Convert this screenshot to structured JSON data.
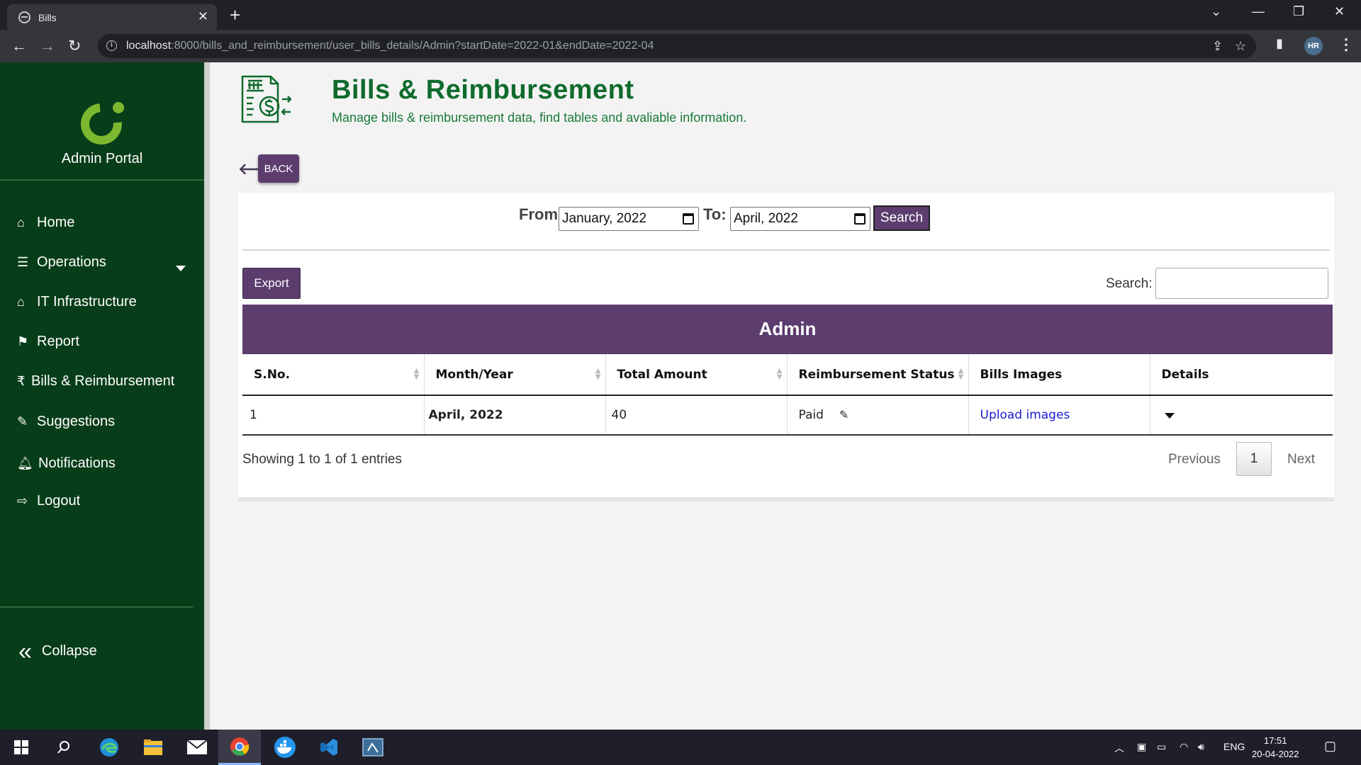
{
  "browser": {
    "tab_title": "Bills",
    "url_host": "localhost",
    "url_rest": ":8000/bills_and_reimbursement/user_bills_details/Admin?startDate=2022-01&endDate=2022-04",
    "profile_initials": "HR"
  },
  "sidebar": {
    "portal_title": "Admin Portal",
    "items": [
      {
        "label": "Home",
        "icon": "home-icon"
      },
      {
        "label": "Operations",
        "icon": "list-icon"
      },
      {
        "label": "IT Infrastructure",
        "icon": "home-icon"
      },
      {
        "label": "Report",
        "icon": "flag-icon"
      },
      {
        "label": "Bills & Reimbursement",
        "icon": "rupee-icon"
      },
      {
        "label": "Suggestions",
        "icon": "edit-icon"
      },
      {
        "label": "Notifications",
        "icon": "bell-icon"
      },
      {
        "label": "Logout",
        "icon": "logout-icon"
      }
    ],
    "collapse_label": "Collapse"
  },
  "header": {
    "title": "Bills & Reimbursement",
    "subtitle": "Manage bills & reimbursement data, find tables and avaliable information."
  },
  "back_label": "BACK",
  "filter": {
    "from_label": "From:",
    "from_value": "January, 2022",
    "to_label": "To:",
    "to_value": "April, 2022",
    "search_label": "Search"
  },
  "toolbar": {
    "export_label": "Export",
    "search_label": "Search:",
    "search_value": ""
  },
  "table": {
    "caption": "Admin",
    "columns": [
      "S.No.",
      "Month/Year",
      "Total Amount",
      "Reimbursement Status",
      "Bills Images",
      "Details"
    ],
    "rows": [
      {
        "sno": "1",
        "month_year": "April, 2022",
        "total": "40",
        "status": "Paid",
        "images_link": "Upload images"
      }
    ]
  },
  "pagination": {
    "info": "Showing 1 to 1 of 1 entries",
    "previous": "Previous",
    "page": "1",
    "next": "Next"
  },
  "taskbar": {
    "lang": "ENG",
    "time": "17:51",
    "date": "20-04-2022"
  },
  "colors": {
    "sidebar_bg": "#083d19",
    "accent_purple": "#5c3d6e",
    "title_green": "#0f6b2c",
    "logo_green": "#7cb82f"
  }
}
